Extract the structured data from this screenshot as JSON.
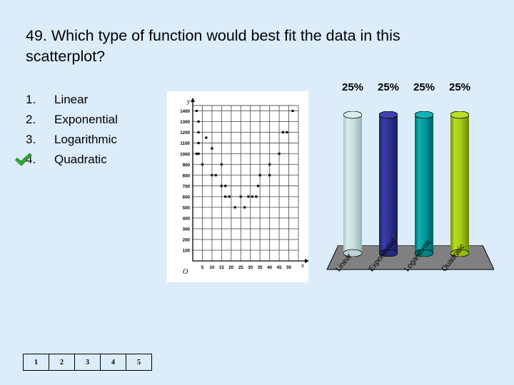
{
  "background_color": "#dcecfb",
  "question": {
    "number": "49.",
    "text": "49.  Which type of function would best fit the data in this scatterplot?"
  },
  "answers": {
    "items": [
      {
        "num": "1.",
        "label": "Linear",
        "checked": false
      },
      {
        "num": "2.",
        "label": "Exponential",
        "checked": false
      },
      {
        "num": "3.",
        "label": "Logarithmic",
        "checked": false
      },
      {
        "num": "4.",
        "label": "Quadratic",
        "checked": true
      }
    ],
    "check_color": "#31a434"
  },
  "chart_data": [
    {
      "type": "scatter",
      "title": "",
      "xlabel": "x",
      "ylabel": "y",
      "xlim": [
        0,
        55
      ],
      "ylim": [
        0,
        1450
      ],
      "xticks": [
        5,
        10,
        15,
        20,
        25,
        30,
        35,
        40,
        45,
        50
      ],
      "yticks": [
        100,
        200,
        300,
        400,
        500,
        600,
        700,
        800,
        900,
        1000,
        1100,
        1200,
        1300,
        1400
      ],
      "grid": true,
      "origin_label": "O",
      "points": [
        [
          2,
          1400
        ],
        [
          3,
          1300
        ],
        [
          3,
          1200
        ],
        [
          3,
          1100
        ],
        [
          2,
          1000
        ],
        [
          3,
          1000
        ],
        [
          7,
          1150
        ],
        [
          5,
          900
        ],
        [
          10,
          1050
        ],
        [
          10,
          800
        ],
        [
          12,
          800
        ],
        [
          15,
          900
        ],
        [
          15,
          700
        ],
        [
          17,
          700
        ],
        [
          17,
          600
        ],
        [
          19,
          600
        ],
        [
          22,
          500
        ],
        [
          27,
          500
        ],
        [
          25,
          600
        ],
        [
          29,
          600
        ],
        [
          31,
          600
        ],
        [
          33,
          600
        ],
        [
          34,
          700
        ],
        [
          35,
          800
        ],
        [
          40,
          800
        ],
        [
          40,
          900
        ],
        [
          45,
          1000
        ],
        [
          47,
          1200
        ],
        [
          49,
          1200
        ],
        [
          52,
          1400
        ]
      ]
    },
    {
      "type": "bar",
      "categories": [
        "Linear",
        "Exponential",
        "Logarithmic",
        "Quadratic"
      ],
      "values": [
        25,
        25,
        25,
        25
      ],
      "value_labels": [
        "25%",
        "25%",
        "25%",
        "25%"
      ],
      "ylim": [
        0,
        100
      ],
      "grid": false,
      "legend": "none",
      "bar_colors": [
        "#c7dedd",
        "#2e3192",
        "#00989a",
        "#a5cd17"
      ],
      "base_color": "#808080"
    }
  ],
  "page_nav": {
    "pages": [
      "1",
      "2",
      "3",
      "4",
      "5"
    ]
  }
}
